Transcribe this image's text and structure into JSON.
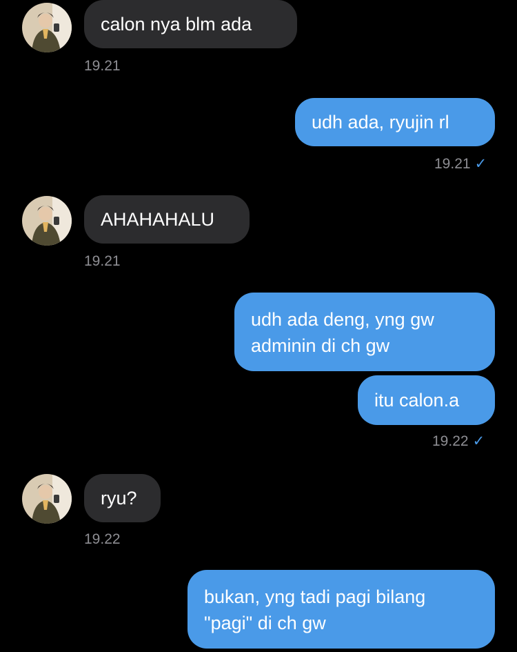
{
  "messages": [
    {
      "text": "calon nya blm ada",
      "time": "19.21"
    },
    {
      "text": "udh ada, ryujin rl",
      "time": "19.21"
    },
    {
      "text": "AHAHAHALU",
      "time": "19.21"
    },
    {
      "text_line1": "udh ada deng, yng gw",
      "text_line2": "adminin di ch gw"
    },
    {
      "text": "itu calon.a",
      "time": "19.22"
    },
    {
      "text": "ryu?",
      "time": "19.22"
    },
    {
      "text_line1": "bukan, yng tadi pagi bilang",
      "text_line2": "\"pagi\" di ch gw"
    }
  ],
  "icons": {
    "read_receipt": "✓",
    "avatar": "avatar-photo"
  },
  "colors": {
    "outgoing": "#4a9ae8",
    "incoming": "#2c2c2e",
    "background": "#000000",
    "timestamp": "#8e8e93"
  }
}
